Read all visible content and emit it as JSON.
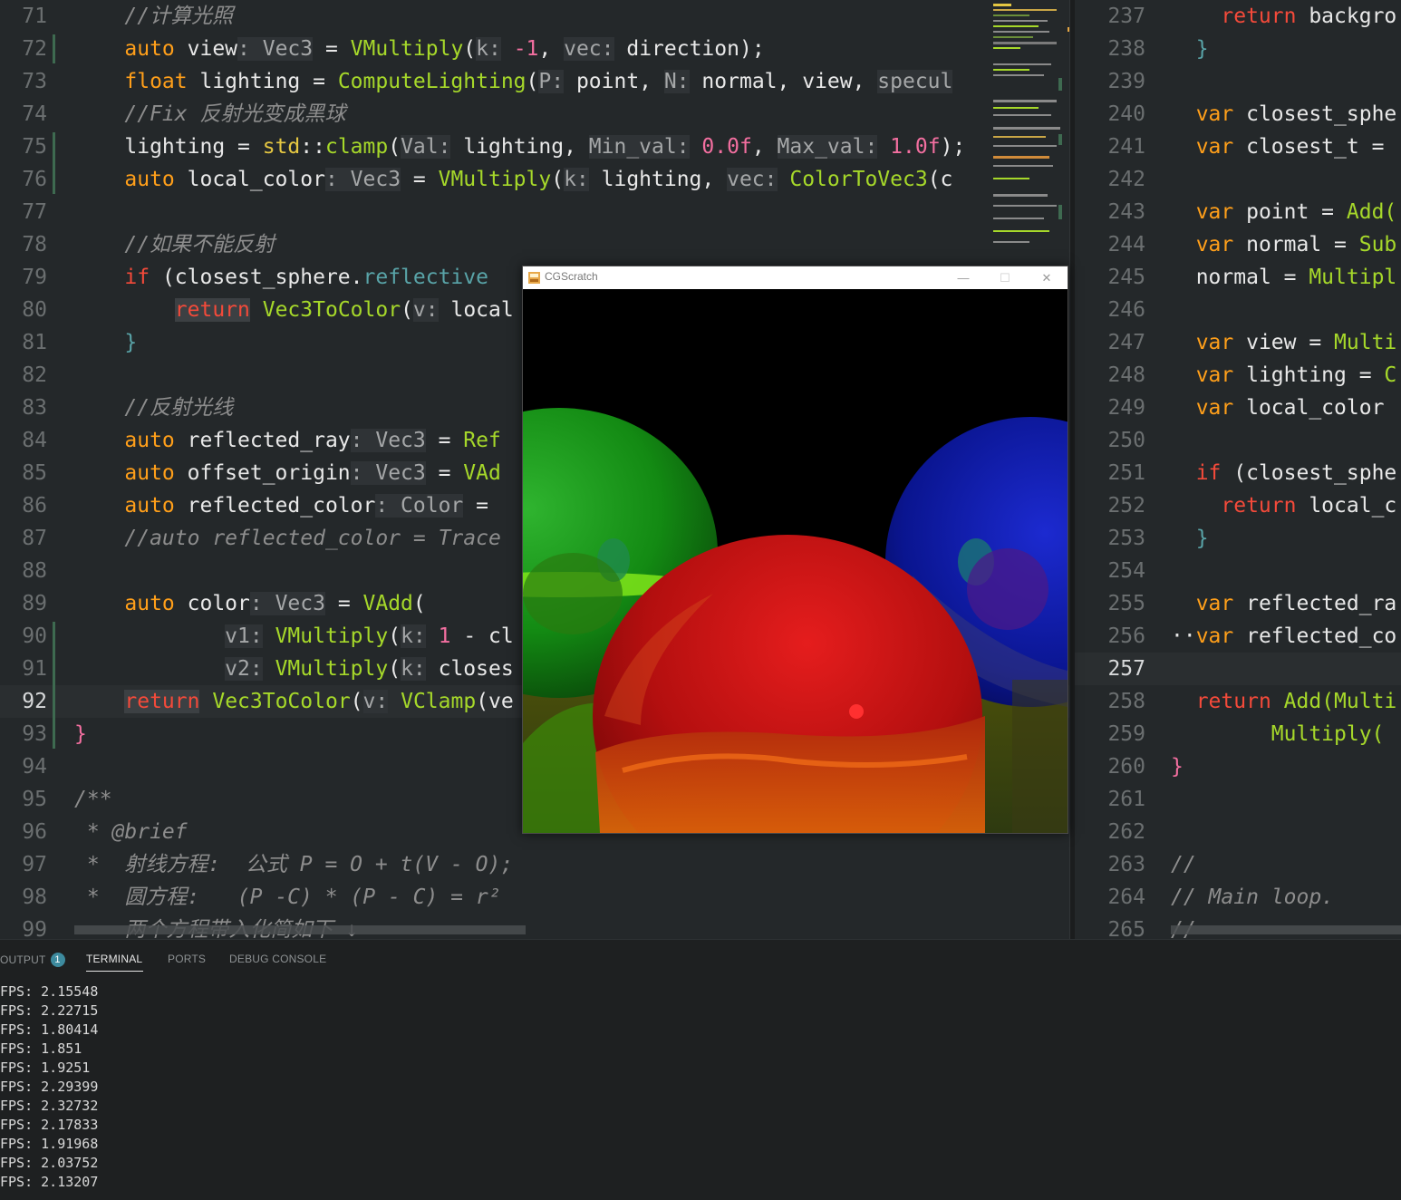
{
  "editor_left": {
    "lines": [
      {
        "n": "71",
        "tokens": [
          [
            "    ",
            ""
          ],
          [
            "//计算光照",
            "k-comment"
          ]
        ]
      },
      {
        "n": "72",
        "tokens": [
          [
            "    ",
            ""
          ],
          [
            "auto",
            "k-orange"
          ],
          [
            " view",
            ""
          ],
          [
            ": Vec3",
            "hint"
          ],
          [
            " = ",
            ""
          ],
          [
            "VMultiply",
            "k-green"
          ],
          [
            "(",
            ""
          ],
          [
            "k:",
            "hint"
          ],
          [
            " -1",
            "k-pink"
          ],
          [
            ", ",
            ""
          ],
          [
            "vec:",
            "hint"
          ],
          [
            " direction",
            ""
          ],
          [
            ");",
            ""
          ]
        ]
      },
      {
        "n": "73",
        "tokens": [
          [
            "    ",
            ""
          ],
          [
            "float",
            "k-orange"
          ],
          [
            " lighting = ",
            ""
          ],
          [
            "ComputeLighting",
            "k-green"
          ],
          [
            "(",
            ""
          ],
          [
            "P:",
            "hint"
          ],
          [
            " point, ",
            ""
          ],
          [
            "N:",
            "hint"
          ],
          [
            " normal, view, ",
            ""
          ],
          [
            "specul",
            "hint"
          ]
        ]
      },
      {
        "n": "74",
        "tokens": [
          [
            "    ",
            ""
          ],
          [
            "//Fix 反射光变成黑球",
            "k-comment"
          ]
        ]
      },
      {
        "n": "75",
        "tokens": [
          [
            "    ",
            ""
          ],
          [
            "lighting = ",
            ""
          ],
          [
            "std",
            "k-yellow"
          ],
          [
            "::",
            ""
          ],
          [
            "clamp",
            "k-green"
          ],
          [
            "(",
            ""
          ],
          [
            "Val:",
            "hint"
          ],
          [
            " lighting, ",
            ""
          ],
          [
            "Min_val:",
            "hint"
          ],
          [
            " 0.0f",
            "k-pink"
          ],
          [
            ", ",
            ""
          ],
          [
            "Max_val:",
            "hint"
          ],
          [
            " 1.0f",
            "k-pink"
          ],
          [
            ");",
            ""
          ]
        ]
      },
      {
        "n": "76",
        "tokens": [
          [
            "    ",
            ""
          ],
          [
            "auto",
            "k-orange"
          ],
          [
            " local_color",
            ""
          ],
          [
            ": Vec3",
            "hint"
          ],
          [
            " = ",
            ""
          ],
          [
            "VMultiply",
            "k-green"
          ],
          [
            "(",
            ""
          ],
          [
            "k:",
            "hint"
          ],
          [
            " lighting, ",
            ""
          ],
          [
            "vec:",
            "hint"
          ],
          [
            " ",
            ""
          ],
          [
            "ColorToVec3",
            "k-green"
          ],
          [
            "(c",
            ""
          ]
        ]
      },
      {
        "n": "77",
        "tokens": []
      },
      {
        "n": "78",
        "tokens": [
          [
            "    ",
            ""
          ],
          [
            "//如果不能反射",
            "k-comment"
          ]
        ]
      },
      {
        "n": "79",
        "tokens": [
          [
            "    ",
            ""
          ],
          [
            "if",
            "k-red"
          ],
          [
            " (closest_sphere.",
            ""
          ],
          [
            "reflective",
            "k-cyan"
          ]
        ]
      },
      {
        "n": "80",
        "tokens": [
          [
            "        ",
            ""
          ],
          [
            "return",
            "k-red hl-bg"
          ],
          [
            " ",
            ""
          ],
          [
            "Vec3ToColor",
            "k-green"
          ],
          [
            "(",
            ""
          ],
          [
            "v:",
            "hint"
          ],
          [
            " local",
            ""
          ]
        ]
      },
      {
        "n": "81",
        "tokens": [
          [
            "    ",
            ""
          ],
          [
            "}",
            "k-cyan"
          ]
        ]
      },
      {
        "n": "82",
        "tokens": []
      },
      {
        "n": "83",
        "tokens": [
          [
            "    ",
            ""
          ],
          [
            "//反射光线",
            "k-comment"
          ]
        ]
      },
      {
        "n": "84",
        "tokens": [
          [
            "    ",
            ""
          ],
          [
            "auto",
            "k-orange"
          ],
          [
            " reflected_ray",
            ""
          ],
          [
            ": Vec3",
            "hint"
          ],
          [
            " = ",
            ""
          ],
          [
            "Ref",
            "k-green"
          ]
        ]
      },
      {
        "n": "85",
        "tokens": [
          [
            "    ",
            ""
          ],
          [
            "auto",
            "k-orange"
          ],
          [
            " offset_origin",
            ""
          ],
          [
            ": Vec3",
            "hint"
          ],
          [
            " = ",
            ""
          ],
          [
            "VAd",
            "k-green"
          ]
        ]
      },
      {
        "n": "86",
        "tokens": [
          [
            "    ",
            ""
          ],
          [
            "auto",
            "k-orange"
          ],
          [
            " reflected_color",
            ""
          ],
          [
            ": Color",
            "hint"
          ],
          [
            " = ",
            ""
          ]
        ]
      },
      {
        "n": "87",
        "tokens": [
          [
            "    ",
            ""
          ],
          [
            "//auto reflected_color = Trace",
            "k-comment"
          ]
        ]
      },
      {
        "n": "88",
        "tokens": []
      },
      {
        "n": "89",
        "tokens": [
          [
            "    ",
            ""
          ],
          [
            "auto",
            "k-orange"
          ],
          [
            " color",
            ""
          ],
          [
            ": Vec3",
            "hint"
          ],
          [
            " = ",
            ""
          ],
          [
            "VAdd",
            "k-green"
          ],
          [
            "(",
            ""
          ]
        ]
      },
      {
        "n": "90",
        "tokens": [
          [
            "            ",
            ""
          ],
          [
            "v1:",
            "hint"
          ],
          [
            " ",
            ""
          ],
          [
            "VMultiply",
            "k-green"
          ],
          [
            "(",
            ""
          ],
          [
            "k:",
            "hint"
          ],
          [
            " 1",
            "k-pink"
          ],
          [
            " - cl",
            ""
          ]
        ]
      },
      {
        "n": "91",
        "tokens": [
          [
            "            ",
            ""
          ],
          [
            "v2:",
            "hint"
          ],
          [
            " ",
            ""
          ],
          [
            "VMultiply",
            "k-green"
          ],
          [
            "(",
            ""
          ],
          [
            "k:",
            "hint"
          ],
          [
            " closes",
            ""
          ]
        ]
      },
      {
        "n": "92",
        "tokens": [
          [
            "    ",
            ""
          ],
          [
            "return",
            "k-red hl-bg"
          ],
          [
            " ",
            ""
          ],
          [
            "Vec3ToColor",
            "k-green"
          ],
          [
            "(",
            ""
          ],
          [
            "v:",
            "hint"
          ],
          [
            " ",
            ""
          ],
          [
            "VClamp",
            "k-green"
          ],
          [
            "(ve",
            ""
          ]
        ]
      },
      {
        "n": "93",
        "tokens": [
          [
            "}",
            "k-pink"
          ]
        ]
      },
      {
        "n": "94",
        "tokens": []
      },
      {
        "n": "95",
        "tokens": [
          [
            "/**",
            "k-comment"
          ]
        ]
      },
      {
        "n": "96",
        "tokens": [
          [
            " * ",
            "k-comment"
          ],
          [
            "@brief",
            "k-orange k-comment"
          ]
        ]
      },
      {
        "n": "97",
        "tokens": [
          [
            " *  射线方程:  公式 P = O + t(V - O);",
            "k-comment"
          ]
        ]
      },
      {
        "n": "98",
        "tokens": [
          [
            " *  圆方程:   (P -C) * (P - C) = r²",
            "k-comment"
          ]
        ]
      },
      {
        "n": "99",
        "tokens": [
          [
            "    两个方程带入化简如下 ↓",
            "k-comment"
          ]
        ]
      }
    ],
    "active_line": "92"
  },
  "editor_right": {
    "lines": [
      {
        "n": "237",
        "tokens": [
          [
            "    ",
            ""
          ],
          [
            "return",
            "k-red"
          ],
          [
            " backgro",
            ""
          ]
        ]
      },
      {
        "n": "238",
        "tokens": [
          [
            "  ",
            ""
          ],
          [
            "}",
            "k-cyan"
          ]
        ]
      },
      {
        "n": "239",
        "tokens": []
      },
      {
        "n": "240",
        "tokens": [
          [
            "  ",
            ""
          ],
          [
            "var",
            "k-orange"
          ],
          [
            " closest_sphe",
            ""
          ]
        ]
      },
      {
        "n": "241",
        "tokens": [
          [
            "  ",
            ""
          ],
          [
            "var",
            "k-orange"
          ],
          [
            " closest_t = ",
            ""
          ]
        ]
      },
      {
        "n": "242",
        "tokens": []
      },
      {
        "n": "243",
        "tokens": [
          [
            "  ",
            ""
          ],
          [
            "var",
            "k-orange"
          ],
          [
            " point = ",
            ""
          ],
          [
            "Add(",
            "k-green"
          ]
        ]
      },
      {
        "n": "244",
        "tokens": [
          [
            "  ",
            ""
          ],
          [
            "var",
            "k-orange"
          ],
          [
            " normal = ",
            ""
          ],
          [
            "Sub",
            "k-green"
          ]
        ]
      },
      {
        "n": "245",
        "tokens": [
          [
            "  ",
            ""
          ],
          [
            "normal = ",
            ""
          ],
          [
            "Multipl",
            "k-green"
          ]
        ]
      },
      {
        "n": "246",
        "tokens": []
      },
      {
        "n": "247",
        "tokens": [
          [
            "  ",
            ""
          ],
          [
            "var",
            "k-orange"
          ],
          [
            " view = ",
            ""
          ],
          [
            "Multi",
            "k-green"
          ]
        ]
      },
      {
        "n": "248",
        "tokens": [
          [
            "  ",
            ""
          ],
          [
            "var",
            "k-orange"
          ],
          [
            " lighting = ",
            ""
          ],
          [
            "C",
            "k-green"
          ]
        ]
      },
      {
        "n": "249",
        "tokens": [
          [
            "  ",
            ""
          ],
          [
            "var",
            "k-orange"
          ],
          [
            " local_color ",
            ""
          ]
        ]
      },
      {
        "n": "250",
        "tokens": []
      },
      {
        "n": "251",
        "tokens": [
          [
            "  ",
            ""
          ],
          [
            "if",
            "k-red"
          ],
          [
            " (closest_sphe",
            ""
          ]
        ]
      },
      {
        "n": "252",
        "tokens": [
          [
            "    ",
            ""
          ],
          [
            "return",
            "k-red"
          ],
          [
            " local_c",
            ""
          ]
        ]
      },
      {
        "n": "253",
        "tokens": [
          [
            "  ",
            ""
          ],
          [
            "}",
            "k-cyan"
          ]
        ]
      },
      {
        "n": "254",
        "tokens": []
      },
      {
        "n": "255",
        "tokens": [
          [
            "  ",
            ""
          ],
          [
            "var",
            "k-orange"
          ],
          [
            " reflected_ra",
            ""
          ]
        ]
      },
      {
        "n": "256",
        "tokens": [
          [
            "··",
            ""
          ],
          [
            "var",
            "k-orange"
          ],
          [
            " reflected_co",
            ""
          ]
        ]
      },
      {
        "n": "257",
        "tokens": []
      },
      {
        "n": "258",
        "tokens": [
          [
            "  ",
            ""
          ],
          [
            "return",
            "k-red"
          ],
          [
            " ",
            ""
          ],
          [
            "Add(",
            "k-green"
          ],
          [
            "Multi",
            "k-green"
          ]
        ]
      },
      {
        "n": "259",
        "tokens": [
          [
            "        ",
            ""
          ],
          [
            "Multiply(",
            "k-green"
          ]
        ]
      },
      {
        "n": "260",
        "tokens": [
          [
            "}",
            "k-pink"
          ]
        ]
      },
      {
        "n": "261",
        "tokens": []
      },
      {
        "n": "262",
        "tokens": []
      },
      {
        "n": "263",
        "tokens": [
          [
            "//",
            "k-comment"
          ]
        ]
      },
      {
        "n": "264",
        "tokens": [
          [
            "// Main loop.",
            "k-comment"
          ]
        ]
      },
      {
        "n": "265",
        "tokens": [
          [
            "//",
            "k-comment"
          ]
        ]
      }
    ],
    "active_line": "257"
  },
  "render_window": {
    "title": "CGScratch",
    "minimize": "—",
    "maximize": "☐",
    "close": "✕"
  },
  "panel": {
    "tabs": [
      {
        "label": "OUTPUT",
        "badge": "1"
      },
      {
        "label": "TERMINAL",
        "active": true
      },
      {
        "label": "PORTS"
      },
      {
        "label": "DEBUG CONSOLE"
      }
    ],
    "terminal_lines": [
      "FPS: 2.15548",
      "FPS: 2.22715",
      "FPS: 1.80414",
      "FPS: 1.851",
      "FPS: 1.9251",
      "FPS: 2.29399",
      "FPS: 2.32732",
      "FPS: 2.17833",
      "FPS: 1.91968",
      "FPS: 2.03752",
      "FPS: 2.13207"
    ]
  }
}
